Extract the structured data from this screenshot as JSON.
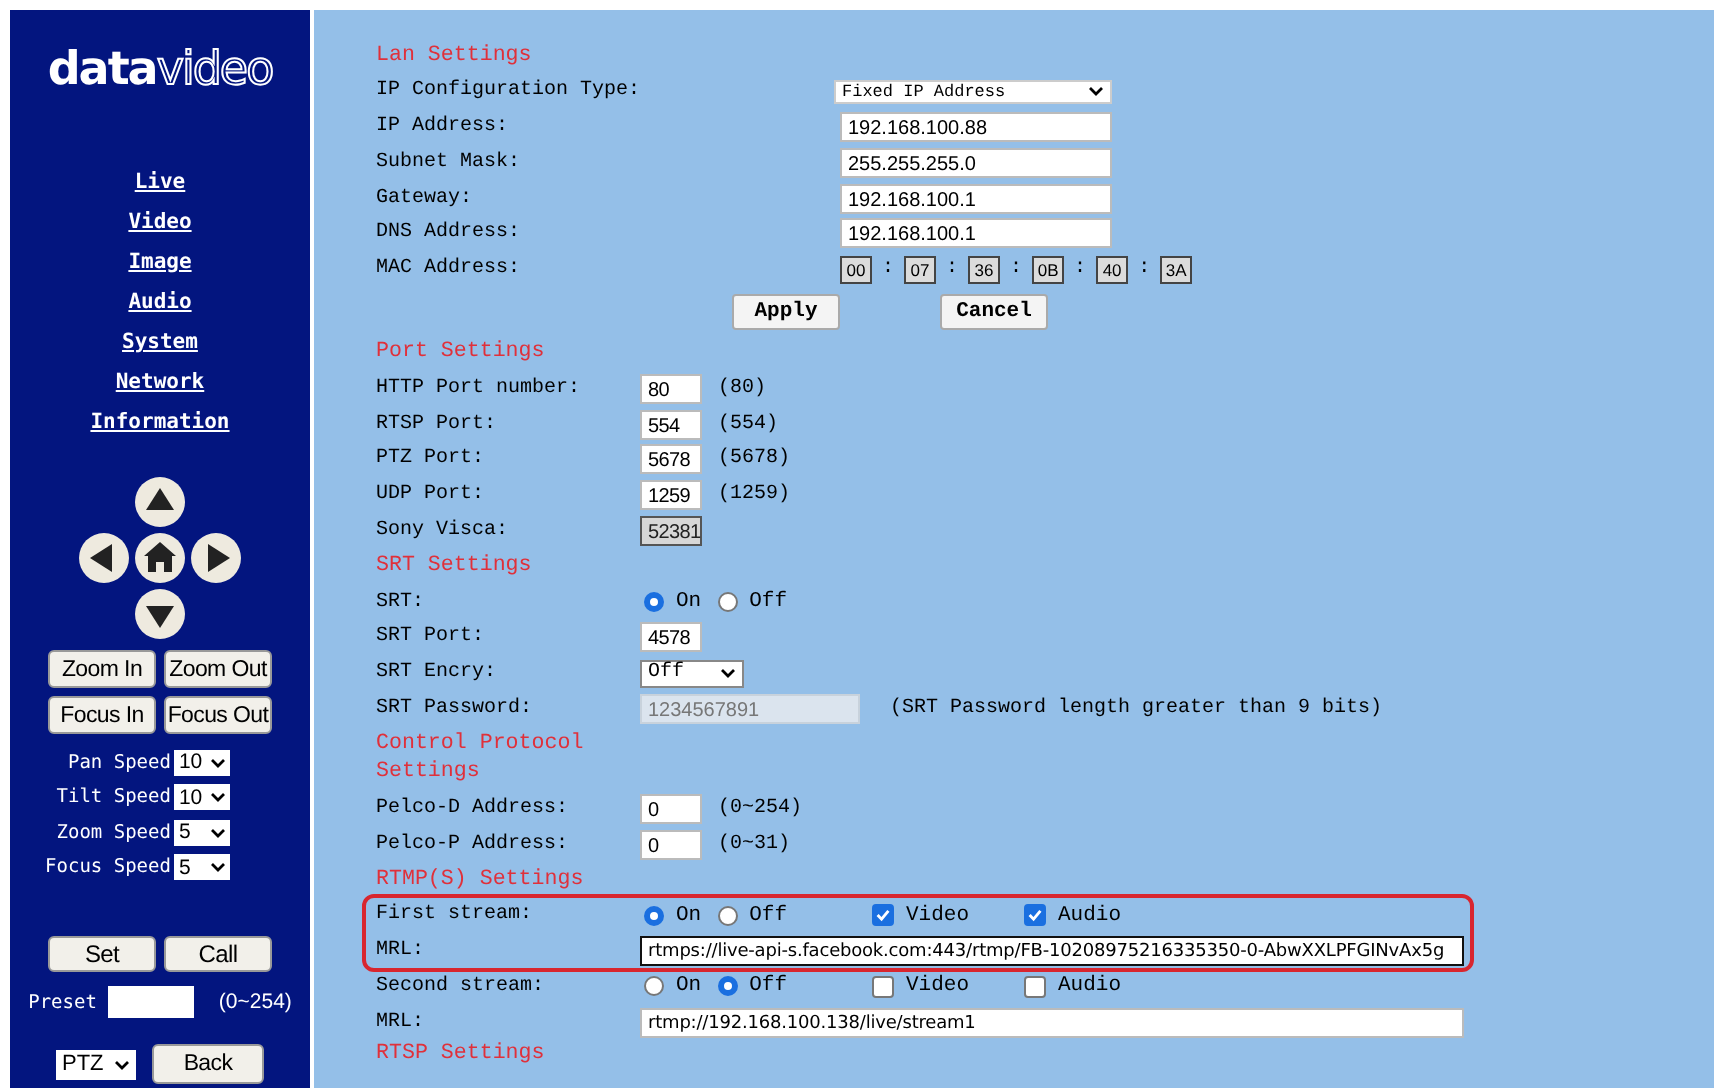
{
  "sidebar": {
    "logo": {
      "bold": "data",
      "outline": "video"
    },
    "nav": [
      {
        "label": "Live"
      },
      {
        "label": "Video"
      },
      {
        "label": "Image"
      },
      {
        "label": "Audio"
      },
      {
        "label": "System"
      },
      {
        "label": "Network"
      },
      {
        "label": "Information"
      }
    ],
    "lens_buttons": [
      "Zoom In",
      "Zoom Out",
      "Focus In",
      "Focus Out"
    ],
    "speeds": [
      {
        "label": "Pan Speed",
        "value": "10"
      },
      {
        "label": "Tilt Speed",
        "value": "10"
      },
      {
        "label": "Zoom Speed",
        "value": "5"
      },
      {
        "label": "Focus Speed",
        "value": "5"
      }
    ],
    "preset_buttons": [
      "Set",
      "Call"
    ],
    "preset": {
      "label": "Preset",
      "range": "(0~254)"
    },
    "mode_select": "PTZ",
    "back_button": "Back"
  },
  "sections": [
    {
      "title": "Lan Settings",
      "kind": "form",
      "rows": [
        {
          "kind": "select",
          "label": "IP Configuration Type:",
          "value": "Fixed IP Address"
        },
        {
          "kind": "input",
          "label": "IP Address:",
          "value": "192.168.100.88",
          "disabled": false
        },
        {
          "kind": "input",
          "label": "Subnet Mask:",
          "value": "255.255.255.0",
          "disabled": false
        },
        {
          "kind": "input",
          "label": "Gateway:",
          "value": "192.168.100.1",
          "disabled": false
        },
        {
          "kind": "input",
          "label": "DNS Address:",
          "value": "192.168.100.1",
          "disabled": false
        },
        {
          "kind": "mac",
          "label": "MAC Address:",
          "values": [
            "00",
            "07",
            "36",
            "0B",
            "40",
            "3A"
          ],
          "separator": ":"
        }
      ],
      "buttons": [
        "Apply",
        "Cancel"
      ]
    },
    {
      "title": "Port Settings",
      "kind": "form",
      "rows": [
        {
          "kind": "input",
          "label": "HTTP Port number:",
          "value": "80",
          "hint": "(80)",
          "disabled": false
        },
        {
          "kind": "input",
          "label": "RTSP Port:",
          "value": "554",
          "hint": "(554)",
          "disabled": false
        },
        {
          "kind": "input",
          "label": "PTZ Port:",
          "value": "5678",
          "hint": "(5678)",
          "disabled": false
        },
        {
          "kind": "input",
          "label": "UDP Port:",
          "value": "1259",
          "hint": "(1259)",
          "disabled": false
        },
        {
          "kind": "input",
          "label": "Sony Visca:",
          "value": "52381",
          "disabled": true
        }
      ]
    },
    {
      "title": "SRT Settings",
      "kind": "form",
      "rows": [
        {
          "kind": "radio",
          "label": "SRT:",
          "options": [
            {
              "label": "On",
              "selected": true
            },
            {
              "label": "Off",
              "selected": false
            }
          ]
        },
        {
          "kind": "input",
          "label": "SRT Port:",
          "value": "4578",
          "disabled": false
        },
        {
          "kind": "select",
          "label": "SRT Encry:",
          "value": "Off"
        },
        {
          "kind": "input",
          "label": "SRT Password:",
          "value": "1234567891",
          "hint": "(SRT Password length greater than 9 bits)",
          "disabled": true
        }
      ]
    },
    {
      "title": "Control Protocol Settings",
      "kind": "form",
      "rows": [
        {
          "kind": "input",
          "label": "Pelco-D Address:",
          "value": "0",
          "hint": "(0~254)",
          "disabled": false
        },
        {
          "kind": "input",
          "label": "Pelco-P Address:",
          "value": "0",
          "hint": "(0~31)",
          "disabled": false
        }
      ]
    },
    {
      "title": "RTMP(S) Settings",
      "kind": "streams",
      "streams": [
        {
          "label": "First stream:",
          "highlighted": true,
          "options": [
            {
              "label": "On",
              "selected": true
            },
            {
              "label": "Off",
              "selected": false
            }
          ],
          "tracks": [
            {
              "label": "Video",
              "checked": true
            },
            {
              "label": "Audio",
              "checked": true
            }
          ],
          "mrl_label": "MRL:",
          "mrl": "rtmps://live-api-s.facebook.com:443/rtmp/FB-10208975216335350-0-AbwXXLPFGINvAx5g",
          "focused": true
        },
        {
          "label": "Second stream:",
          "highlighted": false,
          "options": [
            {
              "label": "On",
              "selected": false
            },
            {
              "label": "Off",
              "selected": true
            }
          ],
          "tracks": [
            {
              "label": "Video",
              "checked": false
            },
            {
              "label": "Audio",
              "checked": false
            }
          ],
          "mrl_label": "MRL:",
          "mrl": "rtmp://192.168.100.138/live/stream1",
          "focused": false
        }
      ]
    },
    {
      "title": "RTSP Settings",
      "kind": "form"
    }
  ]
}
